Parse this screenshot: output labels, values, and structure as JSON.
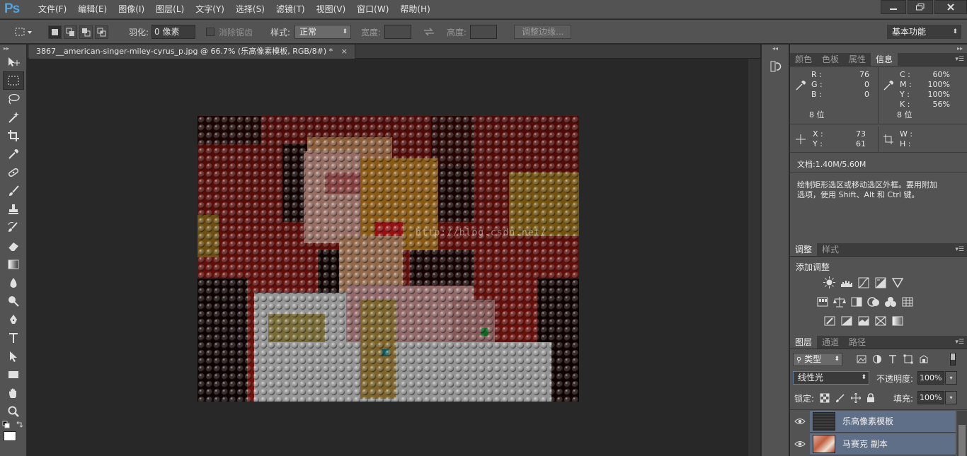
{
  "app": {
    "logo": "Ps"
  },
  "menu": [
    "文件(F)",
    "编辑(E)",
    "图像(I)",
    "图层(L)",
    "文字(Y)",
    "选择(S)",
    "滤镜(T)",
    "视图(V)",
    "窗口(W)",
    "帮助(H)"
  ],
  "options": {
    "feather_label": "羽化:",
    "feather_value": "0 像素",
    "antialias_label": "消除锯齿",
    "style_label": "样式:",
    "style_value": "正常",
    "width_label": "宽度:",
    "height_label": "高度:",
    "refine_edge": "调整边缘...",
    "workspace": "基本功能"
  },
  "document": {
    "tab_title": "3867__american-singer-miley-cyrus_p.jpg @ 66.7% (乐高像素模板, RGB/8#) *",
    "watermark": "http://blog.csdn.net/"
  },
  "info_panel": {
    "tabs": [
      "颜色",
      "色板",
      "属性",
      "信息"
    ],
    "active_tab": "信息",
    "rgb": {
      "r_label": "R :",
      "g_label": "G :",
      "b_label": "B :",
      "r": "76",
      "g": "0",
      "b": "0",
      "bits": "8 位"
    },
    "cmyk": {
      "c_label": "C :",
      "m_label": "M :",
      "y_label": "Y :",
      "k_label": "K :",
      "c": "60%",
      "m": "100%",
      "y": "100%",
      "k": "56%",
      "bits": "8 位"
    },
    "xy": {
      "x_label": "X :",
      "y_label": "Y :",
      "x": "73",
      "y": "61"
    },
    "wh": {
      "w_label": "W :",
      "h_label": "H :"
    },
    "doc_size": "文档:1.40M/5.60M",
    "hint_line1": "绘制矩形选区或移动选区外框。要用附加",
    "hint_line2": "选项，使用 Shift、Alt 和 Ctrl 键。"
  },
  "adjustments_panel": {
    "tabs": [
      "调整",
      "样式"
    ],
    "active_tab": "调整",
    "title": "添加调整"
  },
  "layers_panel": {
    "tabs": [
      "图层",
      "通道",
      "路径"
    ],
    "active_tab": "图层",
    "filter_kind": "类型",
    "blend_mode": "线性光",
    "opacity_label": "不透明度:",
    "opacity": "100%",
    "lock_label": "锁定:",
    "fill_label": "填充:",
    "fill": "100%",
    "layers": [
      {
        "name": "乐高像素模板"
      },
      {
        "name": "马赛克 副本"
      }
    ]
  },
  "colors": {
    "ui_bg": "#535353",
    "canvas_bg": "#282828",
    "selected_layer": "#5f6f88",
    "logo": "#4fa3e0"
  }
}
